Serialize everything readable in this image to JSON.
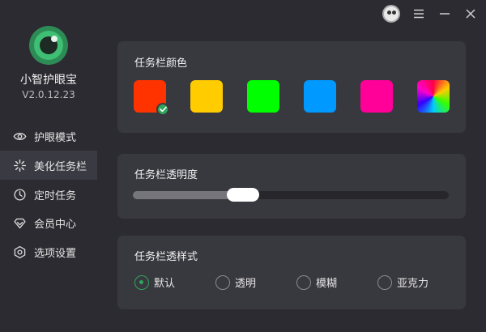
{
  "app": {
    "name": "小智护眼宝",
    "version": "V2.0.12.23"
  },
  "sidebar": {
    "items": [
      {
        "label": "护眼模式",
        "icon": "eye-icon",
        "active": false
      },
      {
        "label": "美化任务栏",
        "icon": "sparkle-icon",
        "active": true
      },
      {
        "label": "定时任务",
        "icon": "clock-icon",
        "active": false
      },
      {
        "label": "会员中心",
        "icon": "diamond-icon",
        "active": false
      },
      {
        "label": "选项设置",
        "icon": "hexagon-settings-icon",
        "active": false
      }
    ]
  },
  "titlebar": {
    "icons": [
      "avatar",
      "menu-icon",
      "minimize-icon",
      "close-icon"
    ]
  },
  "taskbar_color": {
    "title": "任务栏颜色",
    "swatches": [
      {
        "color": "#ff3300",
        "selected": true
      },
      {
        "color": "#ffcc00",
        "selected": false
      },
      {
        "color": "#00ff00",
        "selected": false
      },
      {
        "color": "#0099ff",
        "selected": false
      },
      {
        "color": "#ff0099",
        "selected": false
      },
      {
        "color": "rainbow",
        "selected": false
      }
    ],
    "accent": "#2fa55c"
  },
  "taskbar_opacity": {
    "title": "任务栏透明度",
    "value_fraction": 0.33
  },
  "taskbar_style": {
    "title": "任务栏透样式",
    "options": [
      {
        "label": "默认",
        "selected": true
      },
      {
        "label": "透明",
        "selected": false
      },
      {
        "label": "模糊",
        "selected": false
      },
      {
        "label": "亚克力",
        "selected": false
      }
    ]
  }
}
